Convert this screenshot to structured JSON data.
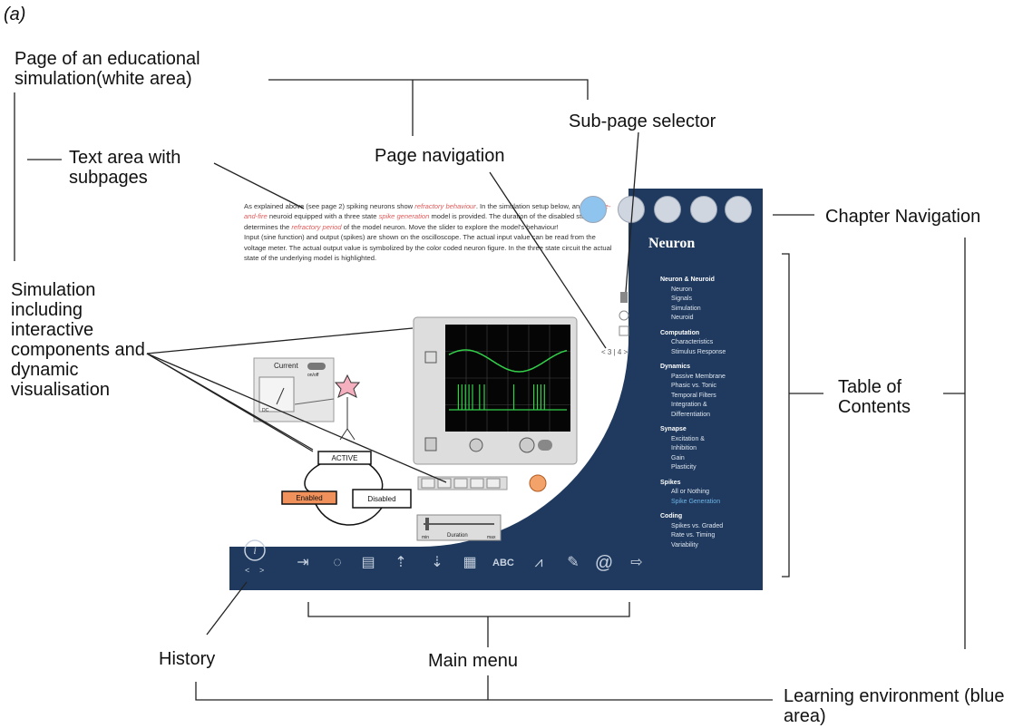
{
  "figure_label": "(a)",
  "labels": {
    "page_of_sim": "Page of an educational simulation(white area)",
    "text_area": "Text area with subpages",
    "page_navigation": "Page navigation",
    "sub_page_selector": "Sub-page selector",
    "chapter_navigation": "Chapter Navigation",
    "simulation": "Simulation including interactive components and dynamic visualisation",
    "table_of_contents": "Table of Contents",
    "history": "History",
    "main_menu": "Main menu",
    "learning_environment": "Learning environment (blue area)"
  },
  "screenshot": {
    "chapter_title": "Neuron",
    "intro_parts": [
      "As explained above (see page 2) spiking neurons show ",
      "refractory behaviour",
      ". In the simulation setup below, an ",
      "integrate-and-fire",
      " neuroid equipped with a three state ",
      "spike generation",
      " model is provided. The duration of the disabled state determines the ",
      "refractory period",
      " of the model neuron. Move the slider to explore the model's behaviour!",
      "Input (sine function) and output (spikes) are shown on the oscilloscope. The actual input value can be read from the voltage meter. The actual output value is symbolized by the color coded neuron figure. In the three state circuit the actual state of the underlying model is highlighted."
    ],
    "subpage_indicator": "< 3 | 4 >",
    "current_label": "Current",
    "onoff_label": "on/off",
    "dc_label": "DC",
    "state_active": "ACTIVE",
    "state_enabled": "Enabled",
    "state_disabled": "Disabled",
    "slider_min": "min",
    "slider_caption": "Duration",
    "slider_max": "max",
    "history_icon": "info-icon",
    "toc": [
      {
        "title": "Neuron & Neuroid",
        "items": [
          "Neuron",
          "Signals",
          "Simulation",
          "Neuroid"
        ]
      },
      {
        "title": "Computation",
        "items": [
          "Characteristics",
          "Stimulus Response"
        ]
      },
      {
        "title": "Dynamics",
        "items": [
          "Passive Membrane",
          "Phasic vs. Tonic",
          "Temporal Filters",
          "Integration &",
          "Differentiation"
        ]
      },
      {
        "title": "Synapse",
        "items": [
          "Excitation &",
          "Inhibition",
          "Gain",
          "Plasticity"
        ]
      },
      {
        "title": "Spikes",
        "items": [
          "All or Nothing",
          "Spike Generation"
        ]
      },
      {
        "title": "Coding",
        "items": [
          "Spikes vs. Graded",
          "Rate vs. Timing",
          "Variability"
        ]
      }
    ],
    "toc_selected": "Spike Generation",
    "menu_abc": "ABC",
    "menu_at": "@",
    "colors": {
      "panel_blue": "#1f3a5e",
      "highlight_red": "#e05a5a",
      "enabled_orange": "#f0905a",
      "scope_green": "#33d04a"
    }
  }
}
